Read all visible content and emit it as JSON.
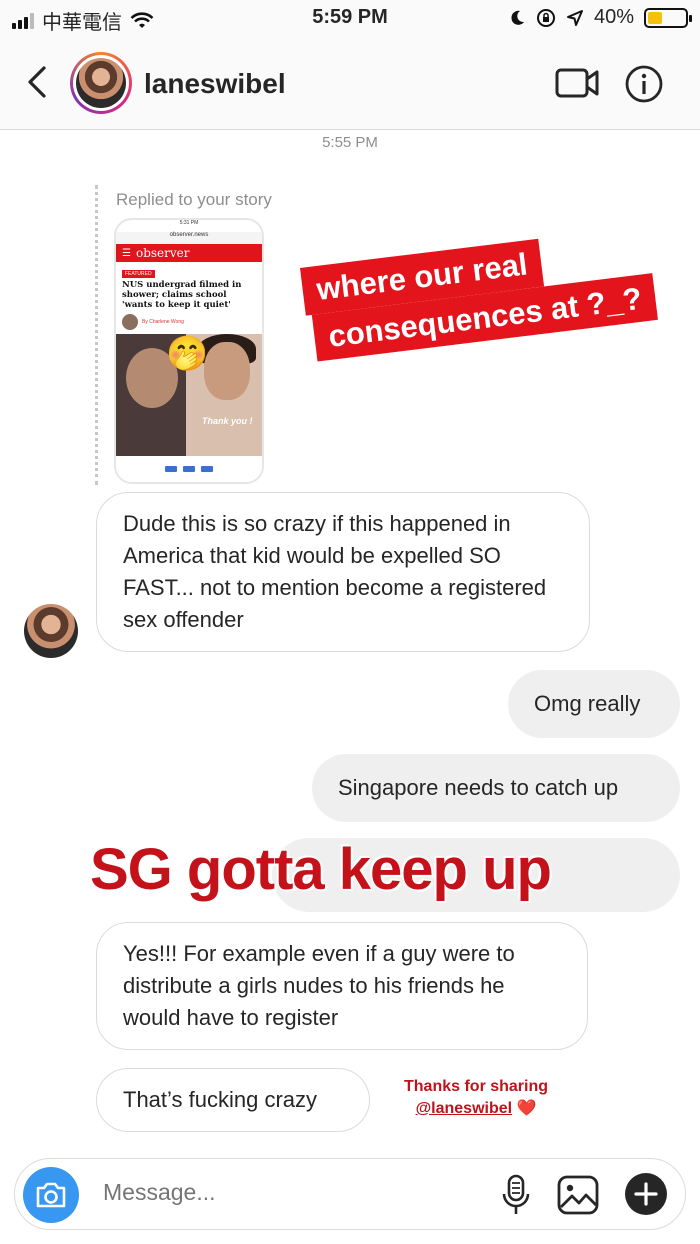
{
  "status_bar": {
    "carrier": "中華電信",
    "time": "5:59 PM",
    "battery": "40%",
    "battery_level": 0.4
  },
  "header": {
    "username": "laneswibel"
  },
  "chat": {
    "timestamp": "5:55 PM",
    "reply_label": "Replied to your story",
    "story": {
      "phone_time": "5:31 PM",
      "url": "observer.news",
      "brand": "observer",
      "tag": "FEATURED",
      "headline": "NUS undergrad filmed in shower; claims school 'wants to keep it quiet'",
      "byline": "By Charlene Wong",
      "photo_text": "Thank you !"
    },
    "sticker_story": [
      "where our real",
      "consequences at ?_?"
    ],
    "messages": [
      {
        "side": "in",
        "text": "Dude this is so crazy if this happened in America that kid would be expelled SO FAST... not to mention become a registered sex offender"
      },
      {
        "side": "out",
        "text": "Omg really"
      },
      {
        "side": "out",
        "text": "Singapore needs to catch up"
      },
      {
        "side": "in",
        "text": "Yes!!! For example even if a guy were to distribute a girls nudes to his friends he would have to register"
      },
      {
        "side": "in",
        "text": "That’s fucking crazy"
      }
    ],
    "sticker_overlay": "SG gotta keep up",
    "sticker_thanks": {
      "line1": "Thanks for sharing",
      "mention": "@laneswibel",
      "heart": "❤️"
    }
  },
  "composer": {
    "placeholder": "Message..."
  },
  "colors": {
    "accent_blue": "#3897f0",
    "sticker_red": "#e3141c",
    "bubble_grey": "#efefef"
  }
}
